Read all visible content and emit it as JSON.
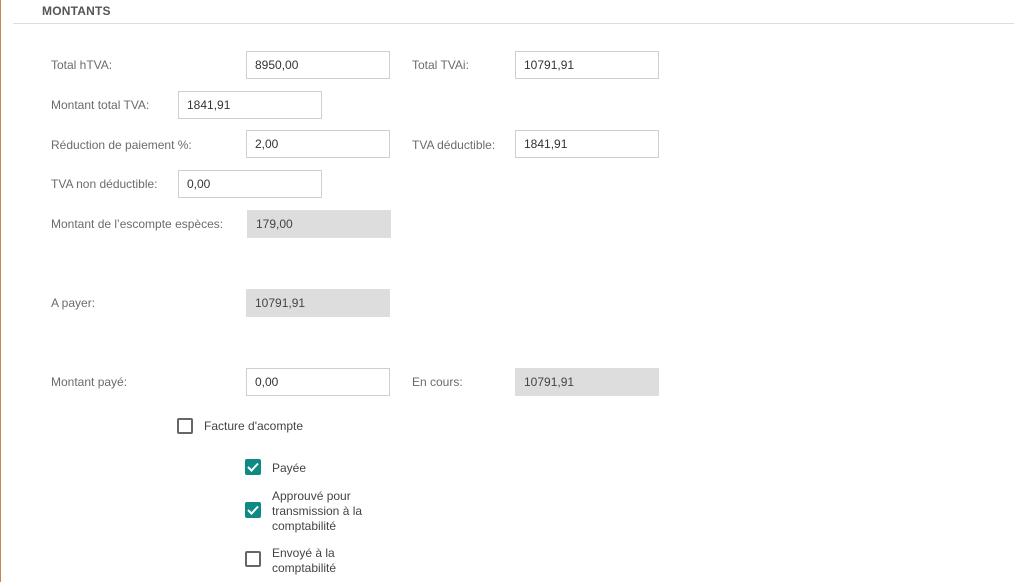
{
  "section": {
    "title": "MONTANTS"
  },
  "fields": {
    "total_htva": {
      "label": "Total hTVA:",
      "value": "8950,00"
    },
    "total_tvai": {
      "label": "Total TVAi:",
      "value": "10791,91"
    },
    "montant_total_tva": {
      "label": "Montant total TVA:",
      "value": "1841,91"
    },
    "reduction_paiement": {
      "label": "Réduction de paiement %:",
      "value": "2,00"
    },
    "tva_deductible": {
      "label": "TVA déductible:",
      "value": "1841,91"
    },
    "tva_non_deductible": {
      "label": "TVA non déductible:",
      "value": "0,00"
    },
    "escompte_especes": {
      "label": "Montant de l’escompte espèces:",
      "value": "179,00"
    },
    "a_payer": {
      "label": "A payer:",
      "value": "10791,91"
    },
    "montant_paye": {
      "label": "Montant payé:",
      "value": "0,00"
    },
    "en_cours": {
      "label": "En cours:",
      "value": "10791,91"
    }
  },
  "checkboxes": {
    "facture_acompte": {
      "label": "Facture d'acompte",
      "checked": false
    },
    "payee": {
      "label": "Payée",
      "checked": true
    },
    "approuve": {
      "label": "Approuvé pour transmission à la comptabilité",
      "checked": true
    },
    "envoye": {
      "label": "Envoyé à la comptabilité",
      "checked": false
    }
  },
  "colors": {
    "accent": "#0f8a82",
    "readonly_bg": "#dddddd",
    "frame_border": "#c9864f"
  }
}
